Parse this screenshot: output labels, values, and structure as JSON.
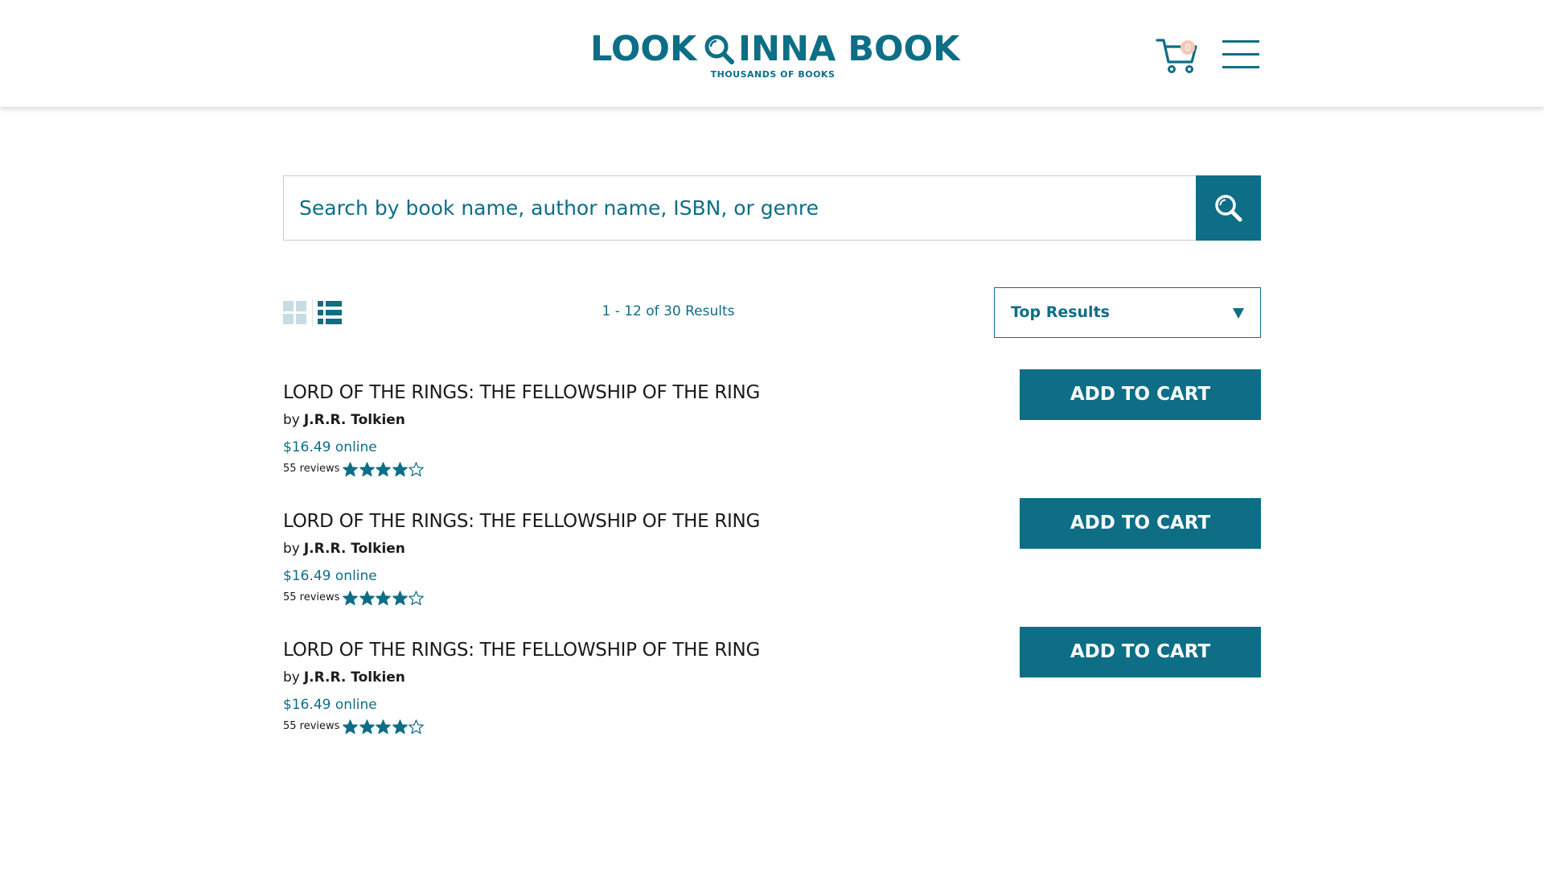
{
  "header": {
    "logo_word1": "LOOK",
    "logo_word2": "INNA BOOK",
    "logo_tagline": "THOUSANDS OF BOOKS",
    "cart_count": "0"
  },
  "search": {
    "placeholder": "Search by book name, author name, ISBN, or genre"
  },
  "toolbar": {
    "results_count": "1 - 12 of 30 Results",
    "sort_selected": "Top Results"
  },
  "results": [
    {
      "title": "LORD OF THE RINGS: THE FELLOWSHIP OF THE RING",
      "by": "by",
      "author": "J.R.R. Tolkien",
      "price": "$16.49 online",
      "reviews": "55 reviews",
      "rating": 4,
      "max_rating": 5,
      "button": "ADD TO CART"
    },
    {
      "title": "LORD OF THE RINGS: THE FELLOWSHIP OF THE RING",
      "by": "by",
      "author": "J.R.R. Tolkien",
      "price": "$16.49 online",
      "reviews": "55 reviews",
      "rating": 4,
      "max_rating": 5,
      "button": "ADD TO CART"
    },
    {
      "title": "LORD OF THE RINGS: THE FELLOWSHIP OF THE RING",
      "by": "by",
      "author": "J.R.R. Tolkien",
      "price": "$16.49 online",
      "reviews": "55 reviews",
      "rating": 4,
      "max_rating": 5,
      "button": "ADD TO CART"
    }
  ],
  "icons": {
    "logo": "magnifier-icon",
    "cart": "shopping-cart-icon",
    "menu": "hamburger-menu-icon",
    "search": "search-icon",
    "grid": "grid-view-icon",
    "list": "list-view-icon",
    "sort": "caret-down-icon",
    "rating": "star-icon"
  },
  "colors": {
    "brand": "#0d6e86",
    "badge": "#f6c9b6",
    "grid_inactive": "#c5dde3"
  }
}
